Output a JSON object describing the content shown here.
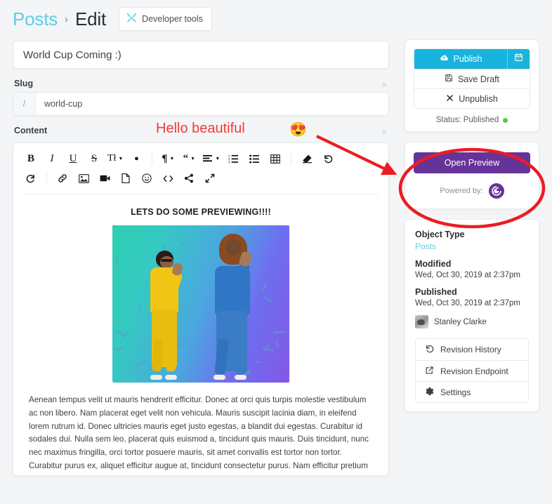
{
  "header": {
    "breadcrumb_root": "Posts",
    "breadcrumb_sep": "›",
    "breadcrumb_current": "Edit",
    "devtools_label": "Developer tools",
    "devtools_icon": "crossed-tools-icon"
  },
  "form": {
    "title_value": "World Cup Coming :)",
    "slug_label": "Slug",
    "slug_prefix": "/",
    "slug_value": "world-cup",
    "content_label": "Content",
    "close_icon": "×"
  },
  "toolbar": {
    "row1": [
      {
        "name": "bold-button",
        "glyph": "B",
        "cls": "tb-b",
        "caret": false
      },
      {
        "name": "italic-button",
        "glyph": "I",
        "cls": "tb-i",
        "caret": false
      },
      {
        "name": "underline-button",
        "glyph": "U",
        "cls": "tb-u",
        "caret": false
      },
      {
        "name": "strikethrough-button",
        "glyph": "S",
        "cls": "tb-s",
        "caret": false
      },
      {
        "name": "text-size-dropdown",
        "glyph": "Tł",
        "cls": "tb-tl",
        "caret": true
      },
      {
        "name": "text-color-button",
        "glyph": "●",
        "cls": "tb-drop",
        "caret": false
      },
      {
        "sep": true
      },
      {
        "name": "paragraph-format-dropdown",
        "glyph": "¶",
        "cls": "tb-q",
        "caret": true
      },
      {
        "name": "blockquote-dropdown",
        "glyph": "“",
        "cls": "tb-q",
        "caret": true
      },
      {
        "name": "align-dropdown",
        "glyph": "align",
        "cls": "tb-icon",
        "caret": true
      },
      {
        "name": "ordered-list-button",
        "glyph": "ol",
        "cls": "tb-icon",
        "caret": false
      },
      {
        "name": "unordered-list-button",
        "glyph": "ul",
        "cls": "tb-icon",
        "caret": false
      },
      {
        "name": "table-button",
        "glyph": "table",
        "cls": "tb-icon",
        "caret": false
      },
      {
        "sep": true
      },
      {
        "name": "clear-format-button",
        "glyph": "eraser",
        "cls": "tb-icon",
        "caret": false
      },
      {
        "name": "undo-button",
        "glyph": "undo",
        "cls": "tb-icon",
        "caret": false
      }
    ],
    "row2": [
      {
        "name": "redo-button",
        "glyph": "redo",
        "cls": "tb-icon",
        "caret": false
      },
      {
        "sep": true
      },
      {
        "name": "link-button",
        "glyph": "link",
        "cls": "tb-icon",
        "caret": false
      },
      {
        "name": "image-button",
        "glyph": "image",
        "cls": "tb-icon",
        "caret": false
      },
      {
        "name": "video-button",
        "glyph": "video",
        "cls": "tb-icon",
        "caret": false
      },
      {
        "name": "file-button",
        "glyph": "file",
        "cls": "tb-icon",
        "caret": false
      },
      {
        "name": "emoji-button",
        "glyph": "emoji",
        "cls": "tb-icon",
        "caret": false
      },
      {
        "name": "code-button",
        "glyph": "code",
        "cls": "tb-icon",
        "caret": false
      },
      {
        "name": "share-button",
        "glyph": "share",
        "cls": "tb-icon",
        "caret": false
      },
      {
        "name": "fullscreen-button",
        "glyph": "expand",
        "cls": "tb-icon",
        "caret": false
      }
    ]
  },
  "document": {
    "heading": "LETS DO SOME PREVIEWING!!!!",
    "image_alt": "two-dancers-on-gradient-background",
    "body": "Aenean tempus velit ut mauris hendrerit efficitur. Donec at orci quis turpis molestie vestibulum ac non libero. Nam placerat eget velit non vehicula. Mauris suscipit lacinia diam, in eleifend lorem rutrum id. Donec ultricies mauris eget justo egestas, a blandit dui egestas. Curabitur id sodales dui. Nulla sem leo, placerat quis euismod a, tincidunt quis mauris. Duis tincidunt, nunc nec maximus fringilla, orci tortor posuere mauris, sit amet convallis est tortor non tortor. Curabitur purus ex, aliquet efficitur augue at, tincidunt consectetur purus. Nam efficitur pretium congue."
  },
  "publish_panel": {
    "publish_label": "Publish",
    "publish_icon": "cloud-upload-icon",
    "schedule_icon": "calendar-icon",
    "save_draft_label": "Save Draft",
    "save_draft_icon": "save-disk-icon",
    "unpublish_label": "Unpublish",
    "unpublish_icon": "close-x-icon",
    "status_label": "Status: Published",
    "status_color": "#5cc94a",
    "accent_color": "#18b4dd"
  },
  "preview_panel": {
    "open_preview_label": "Open Preview",
    "powered_by_label": "Powered by:",
    "logo_name": "gatsby-logo",
    "logo_glyph": "G",
    "brand_color": "#663399"
  },
  "meta_panel": {
    "object_type_label": "Object Type",
    "object_type_value": "Posts",
    "modified_label": "Modified",
    "modified_value": "Wed, Oct 30, 2019 at 2:37pm",
    "published_label": "Published",
    "published_value": "Wed, Oct 30, 2019 at 2:37pm",
    "author_name": "Stanley Clarke",
    "actions": [
      {
        "label": "Revision History",
        "icon": "history-undo-icon"
      },
      {
        "label": "Revision Endpoint",
        "icon": "external-link-icon"
      },
      {
        "label": "Settings",
        "icon": "gear-icon"
      }
    ]
  },
  "annotations": {
    "text": "Hello beautiful",
    "emoji": "😍",
    "color": "#f33a3a"
  }
}
